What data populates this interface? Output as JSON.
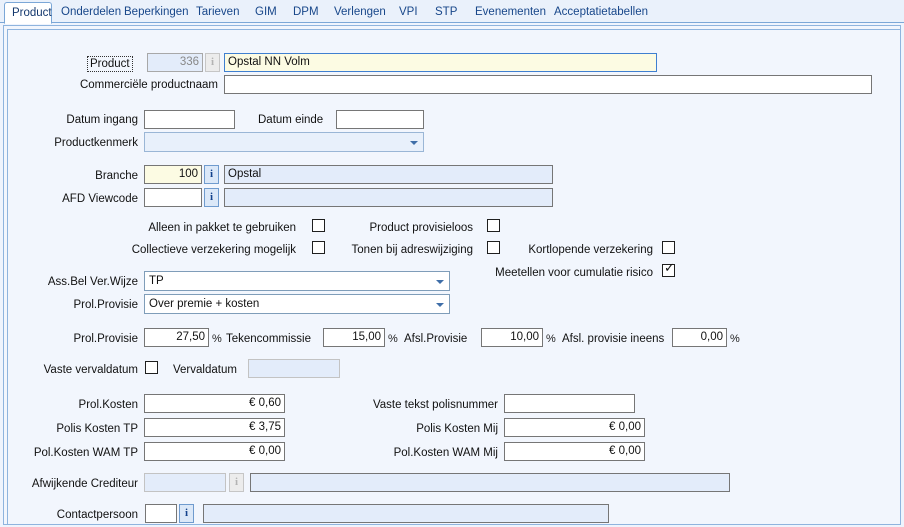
{
  "tabs": [
    {
      "label": "Product",
      "active": true
    },
    {
      "label": "Onderdelen",
      "active": false
    },
    {
      "label": "Beperkingen",
      "active": false
    },
    {
      "label": "Tarieven",
      "active": false
    },
    {
      "label": "GIM",
      "active": false
    },
    {
      "label": "DPM",
      "active": false
    },
    {
      "label": "Verlengen",
      "active": false
    },
    {
      "label": "VPI",
      "active": false
    },
    {
      "label": "STP",
      "active": false
    },
    {
      "label": "Evenementen",
      "active": false
    },
    {
      "label": "Acceptatietabellen",
      "active": false
    }
  ],
  "form": {
    "product": {
      "label": "Product",
      "code": "336",
      "name": "Opstal NN Volm",
      "info_icon": "i"
    },
    "commercial_name": {
      "label": "Commerciële productnaam",
      "value": ""
    },
    "date_start": {
      "label": "Datum ingang",
      "value": ""
    },
    "date_end": {
      "label": "Datum einde",
      "value": ""
    },
    "product_characteristic": {
      "label": "Productkenmerk",
      "value": ""
    },
    "branche": {
      "label": "Branche",
      "code": "100",
      "description": "Opstal",
      "info_icon": "i"
    },
    "afd_viewcode": {
      "label": "AFD Viewcode",
      "code": "",
      "description": "",
      "info_icon": "i"
    },
    "checkboxes": [
      {
        "label": "Alleen in pakket te gebruiken",
        "checked": false
      },
      {
        "label": "Product provisieloos",
        "checked": false
      },
      {
        "label": "Collectieve verzekering mogelijk",
        "checked": false
      },
      {
        "label": "Tonen bij adreswijziging",
        "checked": false
      },
      {
        "label": "Kortlopende verzekering",
        "checked": false
      },
      {
        "label": "Meetellen voor cumulatie risico",
        "checked": true
      }
    ],
    "ass_bel_ver_wijze": {
      "label": "Ass.Bel Ver.Wijze",
      "value": "TP"
    },
    "prol_provisie_combo": {
      "label": "Prol.Provisie",
      "value": "Over premie + kosten"
    },
    "percentages": [
      {
        "label": "Prol.Provisie",
        "value": "27,50",
        "unit": "%"
      },
      {
        "label": "Tekencommissie",
        "value": "15,00",
        "unit": "%"
      },
      {
        "label": "Afsl.Provisie",
        "value": "10,00",
        "unit": "%"
      },
      {
        "label": "Afsl. provisie ineens",
        "value": "0,00",
        "unit": "%"
      }
    ],
    "vaste_vervaldatum": {
      "label": "Vaste vervaldatum",
      "checked": false
    },
    "vervaldatum": {
      "label": "Vervaldatum",
      "value": ""
    },
    "costs_left": [
      {
        "label": "Prol.Kosten",
        "value": "€ 0,60"
      },
      {
        "label": "Polis Kosten TP",
        "value": "€ 3,75"
      },
      {
        "label": "Pol.Kosten WAM TP",
        "value": "€ 0,00"
      }
    ],
    "costs_right": [
      {
        "label": "Vaste tekst polisnummer",
        "value": ""
      },
      {
        "label": "Polis Kosten Mij",
        "value": "€ 0,00"
      },
      {
        "label": "Pol.Kosten WAM Mij",
        "value": "€ 0,00"
      }
    ],
    "afwijkende_crediteur": {
      "label": "Afwijkende Crediteur",
      "code": "",
      "description": "",
      "info_icon": "i"
    },
    "contactpersoon": {
      "label": "Contactpersoon",
      "code": "",
      "description": "",
      "info_icon": "i"
    }
  },
  "colors": {
    "panel_bg": "#f2f6fd",
    "tab_bg": "#eaf1fb",
    "accent": "#7ba7d7",
    "focus_field": "#fcfbe3",
    "readonly_field": "#e3ecfa"
  }
}
